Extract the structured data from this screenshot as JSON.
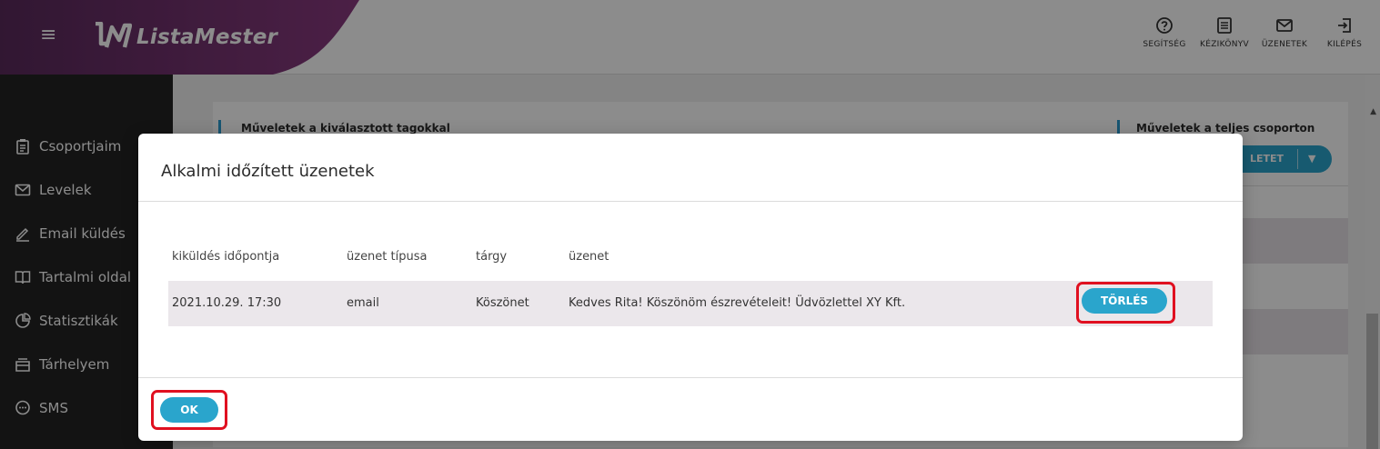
{
  "app": {
    "name": "ListaMester"
  },
  "top_actions": [
    {
      "label": "SEGÍTSÉG",
      "icon": "help-circle-icon"
    },
    {
      "label": "KÉZIKÖNYV",
      "icon": "manual-icon"
    },
    {
      "label": "ÜZENETEK",
      "icon": "mail-icon"
    },
    {
      "label": "KILÉPÉS",
      "icon": "logout-icon"
    }
  ],
  "sidebar": {
    "items": [
      {
        "label": "Csoportjaim",
        "icon": "clipboard-icon"
      },
      {
        "label": "Levelek",
        "icon": "envelope-icon"
      },
      {
        "label": "Email küldés",
        "icon": "pencil-icon"
      },
      {
        "label": "Tartalmi oldal",
        "icon": "book-icon"
      },
      {
        "label": "Statisztikák",
        "icon": "pie-chart-icon"
      },
      {
        "label": "Tárhelyem",
        "icon": "storage-icon"
      },
      {
        "label": "SMS",
        "icon": "sms-bubble-icon"
      }
    ]
  },
  "background": {
    "left_section": "Műveletek a kiválasztott tagokkal",
    "right_section": "Műveletek a teljes csoporton",
    "split_button_label": "LETET"
  },
  "modal": {
    "title": "Alkalmi időzített üzenetek",
    "columns": [
      "kiküldés időpontja",
      "üzenet típusa",
      "tárgy",
      "üzenet"
    ],
    "rows": [
      {
        "time": "2021.10.29. 17:30",
        "type": "email",
        "subject": "Köszönet",
        "message": "Kedves Rita! Köszönöm észrevételeit! Üdvözlettel XY Kft.",
        "action": "TÖRLÉS"
      }
    ],
    "ok_label": "OK"
  },
  "colors": {
    "accent": "#2aa5cc",
    "brand_purple": "#7a3577",
    "highlight": "#e01020",
    "sidebar_bg": "#232323"
  }
}
